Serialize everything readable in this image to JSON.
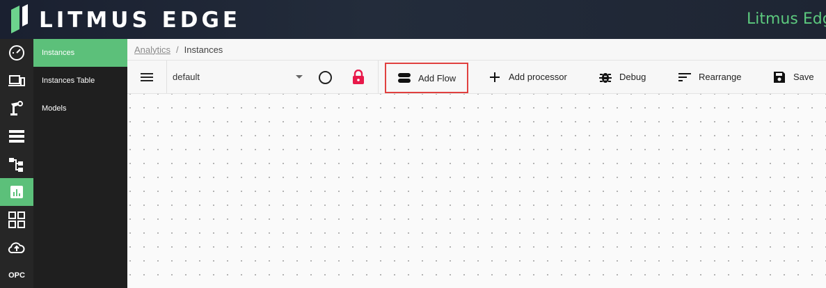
{
  "header": {
    "brand": "LITMUS EDGE",
    "brand_right": "Litmus Edg"
  },
  "rail": {
    "items": [
      {
        "icon": "dashboard-gauge-icon"
      },
      {
        "icon": "devices-icon"
      },
      {
        "icon": "robot-arm-icon"
      },
      {
        "icon": "server-list-icon"
      },
      {
        "icon": "hierarchy-icon"
      },
      {
        "icon": "analytics-chart-icon",
        "active": true
      },
      {
        "icon": "apps-grid-icon"
      },
      {
        "icon": "cloud-upload-icon"
      },
      {
        "label": "OPC"
      }
    ]
  },
  "subnav": {
    "items": [
      {
        "label": "Instances",
        "active": true
      },
      {
        "label": "Instances Table"
      },
      {
        "label": "Models"
      }
    ]
  },
  "breadcrumb": {
    "parent": "Analytics",
    "separator": "/",
    "current": "Instances"
  },
  "toolbar": {
    "flow_select_value": "default",
    "add_flow": "Add Flow",
    "add_processor": "Add processor",
    "debug": "Debug",
    "rearrange": "Rearrange",
    "save": "Save",
    "lock_color": "#e8194a",
    "highlight_color": "#e0403f"
  },
  "colors": {
    "accent": "#5cc07a",
    "brand_right": "#5cc97e"
  }
}
